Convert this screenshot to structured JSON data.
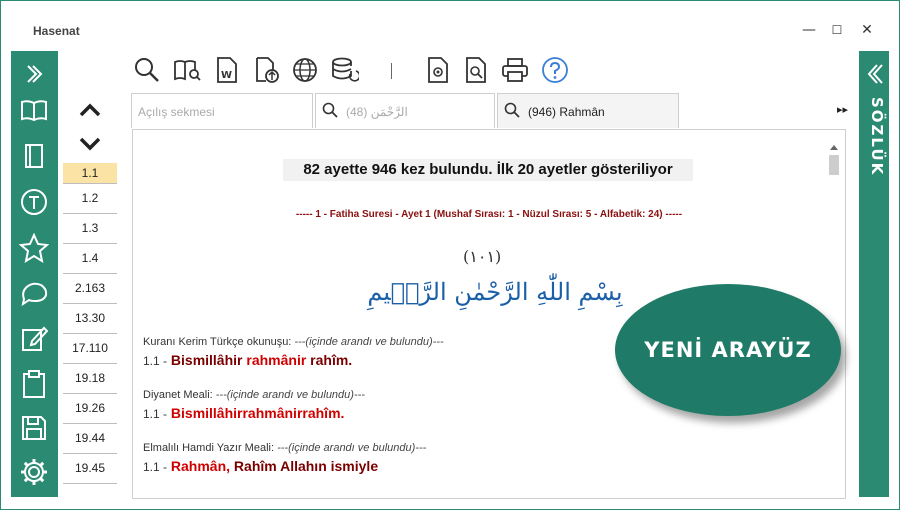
{
  "window": {
    "title": "Hasenat",
    "minimize": "—",
    "maximize": "☐",
    "close": "✕"
  },
  "right_panel": {
    "label": "SÖZLÜK"
  },
  "nav": {
    "verses": [
      "1.1",
      "1.2",
      "1.3",
      "1.4",
      "2.163",
      "13.30",
      "17.110",
      "19.18",
      "19.26",
      "19.44",
      "19.45"
    ],
    "active_index": 0
  },
  "tabs": [
    {
      "label": "Açılış sekmesi"
    },
    {
      "label": "(48) الرَّحْمَن"
    },
    {
      "label": "(946) Rahmân"
    }
  ],
  "tab_overflow": "▸▸",
  "result": {
    "headline": "82 ayette 946 kez bulundu. İlk 20 ayetler gösteriliyor",
    "source": "-----   1 - Fatiha Suresi - Ayet 1 (Mushaf Sırası: 1 - Nüzul Sırası: 5 - Alfabetik: 24)   -----",
    "ayah_number": "(١٠١)",
    "arabic": "بِسْمِ اللّٰهِ الرَّحْمٰنِ الرَّح۪يمِ",
    "blocks": [
      {
        "label": "Kuranı Kerim Türkçe okunuşu:",
        "note": "---(içinde arandı ve bulundu)---",
        "num": "1.1 -",
        "parts": [
          [
            "Bismillâhir ",
            "dark"
          ],
          [
            "rahmânir",
            "red"
          ],
          [
            " rahîm.",
            "dark"
          ]
        ]
      },
      {
        "label": "Diyanet Meali:",
        "note": "---(içinde arandı ve bulundu)---",
        "num": "1.1 -",
        "parts": [
          [
            "Bismillâhirrahmânirrahîm.",
            "red"
          ],
          [
            "",
            "dark"
          ],
          [
            "",
            "dark"
          ]
        ]
      },
      {
        "label": "Elmalılı Hamdi Yazır Meali:",
        "note": "---(içinde arandı ve bulundu)---",
        "num": "1.1 -",
        "parts": [
          [
            "Rahmân,",
            "red"
          ],
          [
            " Rahîm Allahın ismiyle",
            "dark"
          ],
          [
            "",
            "dark"
          ]
        ]
      }
    ]
  },
  "badge": {
    "text": "YENİ ARAYÜZ"
  },
  "colors": {
    "accent": "#2a8a72",
    "badge": "#1f7a67",
    "highlight": "#d00000",
    "active_verse": "#fbe3a5"
  }
}
